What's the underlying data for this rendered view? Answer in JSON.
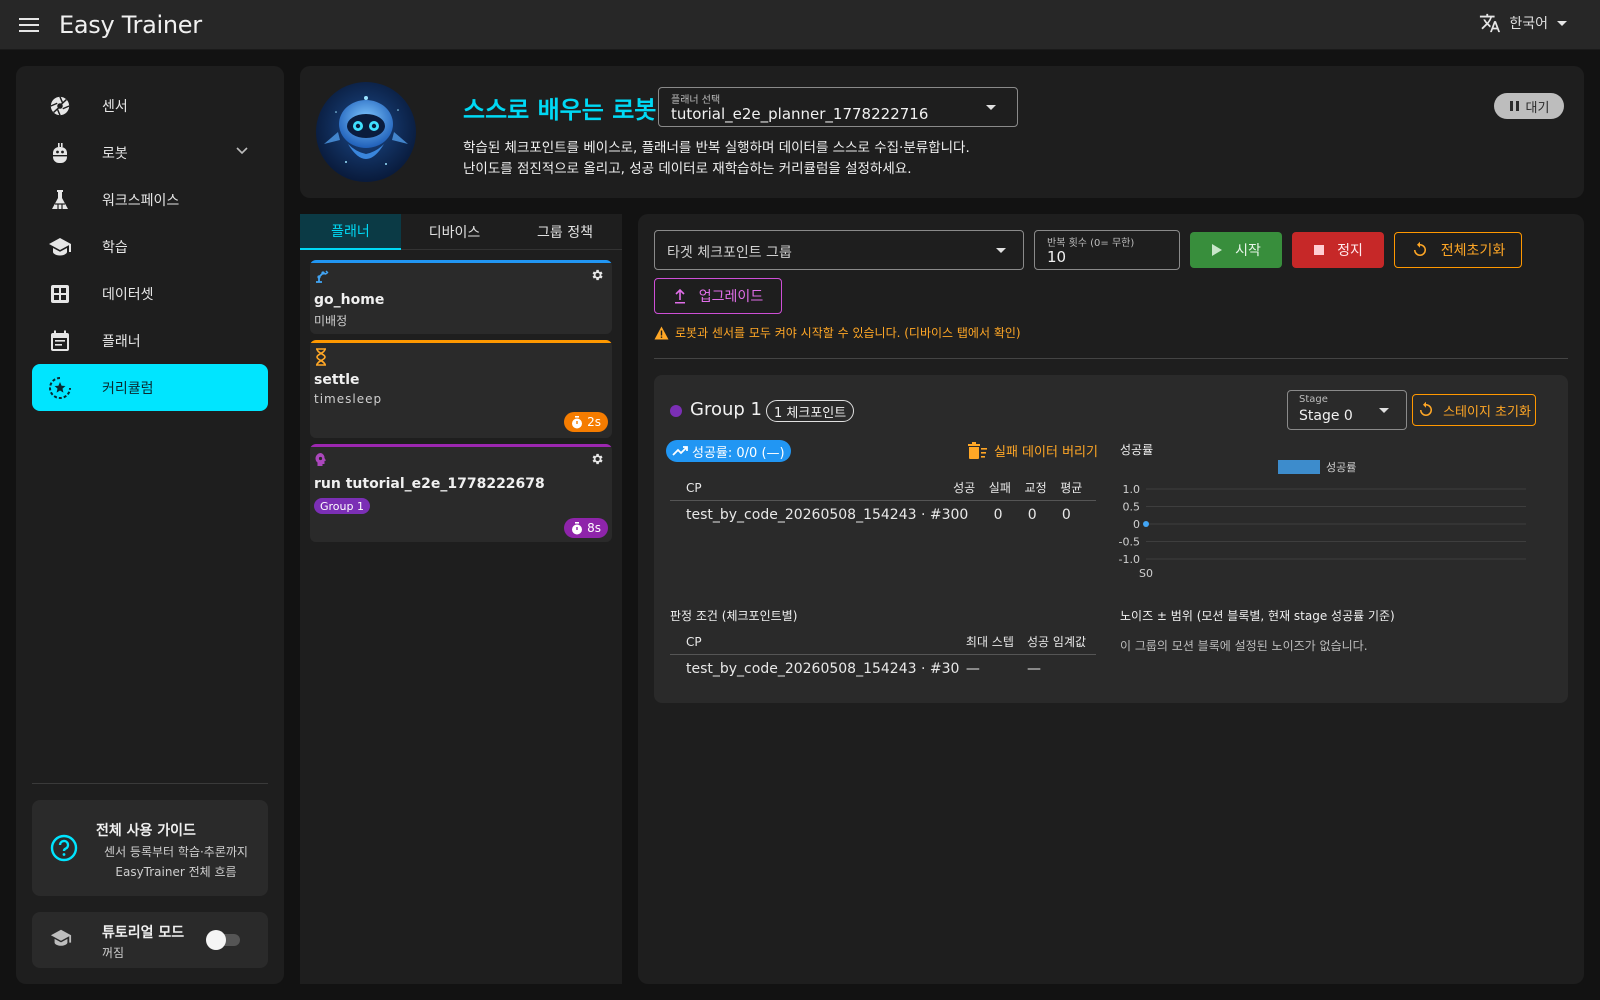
{
  "app": {
    "title": "Easy Trainer",
    "language": "한국어"
  },
  "sidebar": {
    "items": [
      {
        "label": "센서",
        "icon": "camera-shutter-icon"
      },
      {
        "label": "로봇",
        "icon": "robot-icon"
      },
      {
        "label": "워크스페이스",
        "icon": "flask-icon"
      },
      {
        "label": "학습",
        "icon": "graduation-cap-icon"
      },
      {
        "label": "데이터셋",
        "icon": "grid-icon"
      },
      {
        "label": "플래너",
        "icon": "calendar-icon"
      },
      {
        "label": "커리큘럼",
        "icon": "curriculum-icon",
        "active": true
      }
    ],
    "guide": {
      "title": "전체 사용 가이드",
      "line1": "센서 등록부터 학습·추론까지",
      "line2": "EasyTrainer 전체 흐름"
    },
    "tutorial": {
      "title": "튜토리얼 모드",
      "status": "꺼짐",
      "enabled": false
    }
  },
  "header": {
    "title": "스스로 배우는 로봇",
    "planner_select_label": "플래너 선택",
    "planner_select_value": "tutorial_e2e_planner_1778222716",
    "desc_line1": "학습된 체크포인트를 베이스로, 플래너를 반복 실행하며 데이터를 스스로 수집·분류합니다.",
    "desc_line2": "난이도를 점진적으로 올리고, 성공 데이터로 재학습하는 커리큘럼을 설정하세요.",
    "status_badge": "대기"
  },
  "planner_panel": {
    "tabs": [
      "플래너",
      "디바이스",
      "그룹 정책"
    ],
    "cards": [
      {
        "name": "go_home",
        "sub": "미배정",
        "color": "#2196f3"
      },
      {
        "name": "settle",
        "sub": "timesleep",
        "duration": "2s",
        "color": "#ff9800"
      },
      {
        "name": "run tutorial_e2e_1778222678",
        "group": "Group 1",
        "duration": "8s",
        "color": "#9c27b0"
      }
    ]
  },
  "curriculum": {
    "target_placeholder": "타겟 체크포인트 그룹",
    "repeat_label": "반복 횟수 (0= 무한)",
    "repeat_value": "10",
    "start_label": "시작",
    "stop_label": "정지",
    "reset_all_label": "전체초기화",
    "upgrade_label": "업그레이드",
    "warning": "로봇과 센서를 모두 켜야 시작할 수 있습니다. (디바이스 탭에서 확인)",
    "group": {
      "name": "Group 1",
      "checkpoint_chip": "1 체크포인트",
      "stage_label": "Stage",
      "stage_value": "Stage 0",
      "stage_reset_label": "스테이지 초기화",
      "success_rate_chip": "성공률: 0/0 (—)",
      "discard_label": "실패 데이터 버리기",
      "stats_table": {
        "headers": [
          "CP",
          "성공",
          "실패",
          "교정",
          "평균"
        ],
        "rows": [
          [
            "test_by_code_20260508_154243 · #30",
            "0",
            "0",
            "0",
            "0"
          ]
        ]
      },
      "judge_title": "판정 조건 (체크포인트별)",
      "judge_table": {
        "headers": [
          "CP",
          "최대 스텝",
          "성공 임계값"
        ],
        "rows": [
          [
            "test_by_code_20260508_154243 · #30",
            "—",
            "—"
          ]
        ]
      },
      "noise_title": "노이즈 ± 범위 (모션 블록별, 현재 stage 성공률 기준)",
      "noise_empty": "이 그룹의 모션 블록에 설정된 노이즈가 없습니다."
    }
  },
  "chart_data": {
    "type": "line",
    "title": "성공률",
    "categories": [
      "S0"
    ],
    "series": [
      {
        "name": "성공률",
        "values": [
          0
        ],
        "color": "#42a5f5"
      }
    ],
    "yticks": [
      "1.0",
      "0.5",
      "0",
      "-0.5",
      "-1.0"
    ],
    "ylim": [
      -1.0,
      1.0
    ],
    "legend": "top-center",
    "grid": true
  }
}
